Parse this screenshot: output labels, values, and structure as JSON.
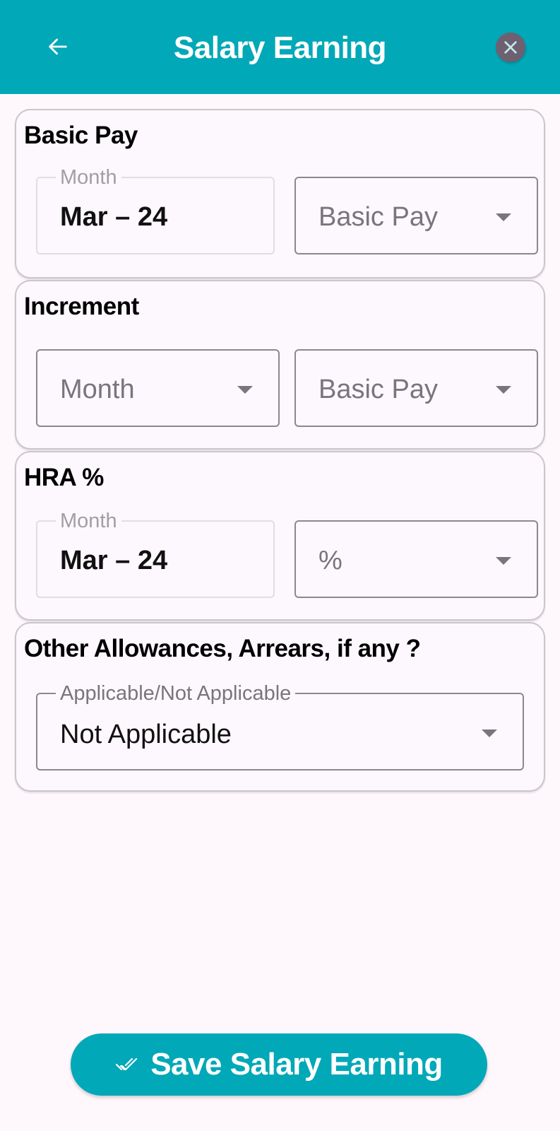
{
  "colors": {
    "primary": "#00a8b8",
    "background": "#fef7fc",
    "close_button": "#6e6070"
  },
  "header": {
    "title": "Salary Earning",
    "back_icon": "arrow-left-icon",
    "close_icon": "close-icon"
  },
  "sections": [
    {
      "title": "Basic Pay",
      "fields": [
        {
          "type": "read-only",
          "label": "Month",
          "value": "Mar – 24"
        },
        {
          "type": "dropdown",
          "placeholder": "Basic Pay",
          "value": ""
        }
      ]
    },
    {
      "title": "Increment",
      "fields": [
        {
          "type": "dropdown",
          "placeholder": "Month",
          "value": ""
        },
        {
          "type": "dropdown",
          "placeholder": "Basic Pay",
          "value": ""
        }
      ]
    },
    {
      "title": "HRA %",
      "fields": [
        {
          "type": "read-only",
          "label": "Month",
          "value": "Mar – 24"
        },
        {
          "type": "dropdown",
          "placeholder": "%",
          "value": ""
        }
      ]
    },
    {
      "title": "Other Allowances, Arrears, if any ?",
      "fields": [
        {
          "type": "dropdown",
          "label": "Applicable/Not Applicable",
          "value": "Not Applicable"
        }
      ]
    }
  ],
  "footer": {
    "save_label": "Save Salary Earning",
    "save_icon": "done-all-icon"
  }
}
